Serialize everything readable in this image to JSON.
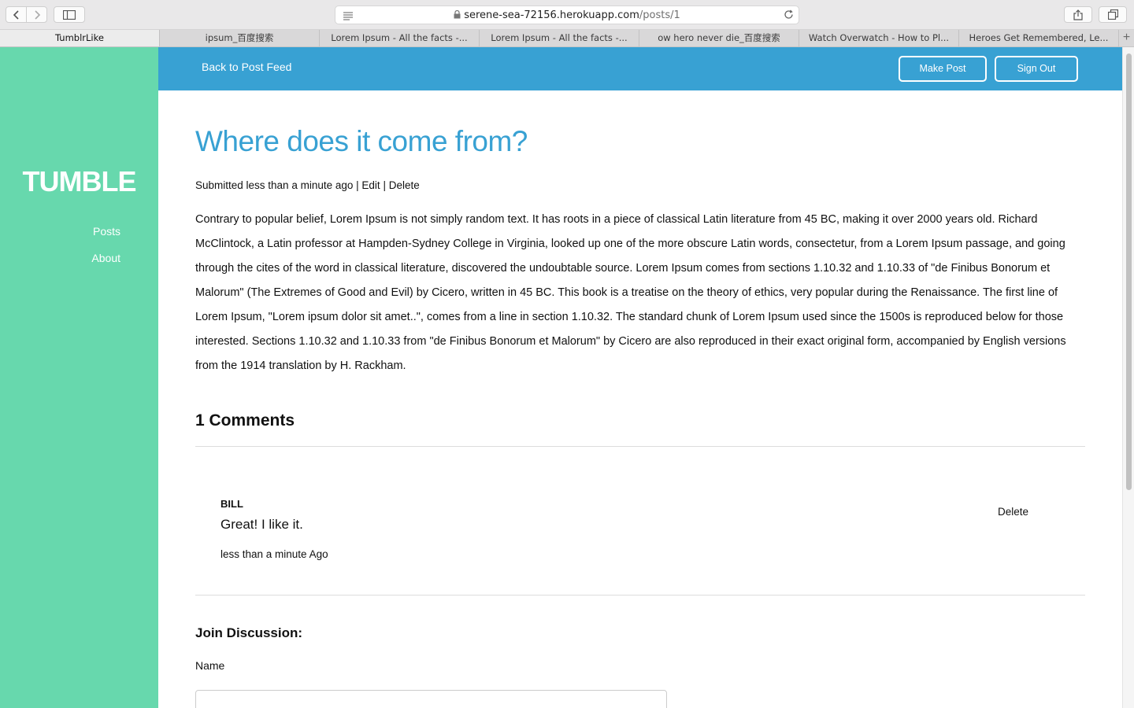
{
  "browser": {
    "url_domain": "serene-sea-72156.herokuapp.com",
    "url_path": "/posts/1",
    "tabs": [
      {
        "label": "TumblrLike",
        "active": true
      },
      {
        "label": "ipsum_百度搜索",
        "active": false
      },
      {
        "label": "Lorem Ipsum - All the facts -...",
        "active": false
      },
      {
        "label": "Lorem Ipsum - All the facts -...",
        "active": false
      },
      {
        "label": "ow hero never die_百度搜索",
        "active": false
      },
      {
        "label": "Watch Overwatch - How to Pl...",
        "active": false
      },
      {
        "label": "Heroes Get Remembered, Le...",
        "active": false
      }
    ],
    "new_tab_label": "+"
  },
  "sidebar": {
    "brand": "TUMBLE",
    "links": [
      "Posts",
      "About"
    ],
    "bg_color": "#67d8ad"
  },
  "topbar": {
    "back_label": "Back to Post Feed",
    "make_post_label": "Make Post",
    "sign_out_label": "Sign Out",
    "bg_color": "#38a1d3"
  },
  "post": {
    "title": "Where does it come from?",
    "submitted": "Submitted less than a minute ago",
    "sep": "|",
    "edit_label": "Edit",
    "delete_label": "Delete",
    "body": "Contrary to popular belief, Lorem Ipsum is not simply random text. It has roots in a piece of classical Latin literature from 45 BC, making it over 2000 years old. Richard McClintock, a Latin professor at Hampden-Sydney College in Virginia, looked up one of the more obscure Latin words, consectetur, from a Lorem Ipsum passage, and going through the cites of the word in classical literature, discovered the undoubtable source. Lorem Ipsum comes from sections 1.10.32 and 1.10.33 of \"de Finibus Bonorum et Malorum\" (The Extremes of Good and Evil) by Cicero, written in 45 BC. This book is a treatise on the theory of ethics, very popular during the Renaissance. The first line of Lorem Ipsum, \"Lorem ipsum dolor sit amet..\", comes from a line in section 1.10.32. The standard chunk of Lorem Ipsum used since the 1500s is reproduced below for those interested. Sections 1.10.32 and 1.10.33 from \"de Finibus Bonorum et Malorum\" by Cicero are also reproduced in their exact original form, accompanied by English versions from the 1914 translation by H. Rackham."
  },
  "comments": {
    "heading": "1 Comments",
    "items": [
      {
        "author": "BILL",
        "text": "Great! I like it.",
        "time": "less than a minute Ago",
        "delete_label": "Delete"
      }
    ]
  },
  "form": {
    "heading": "Join Discussion:",
    "name_label": "Name",
    "name_value": ""
  }
}
